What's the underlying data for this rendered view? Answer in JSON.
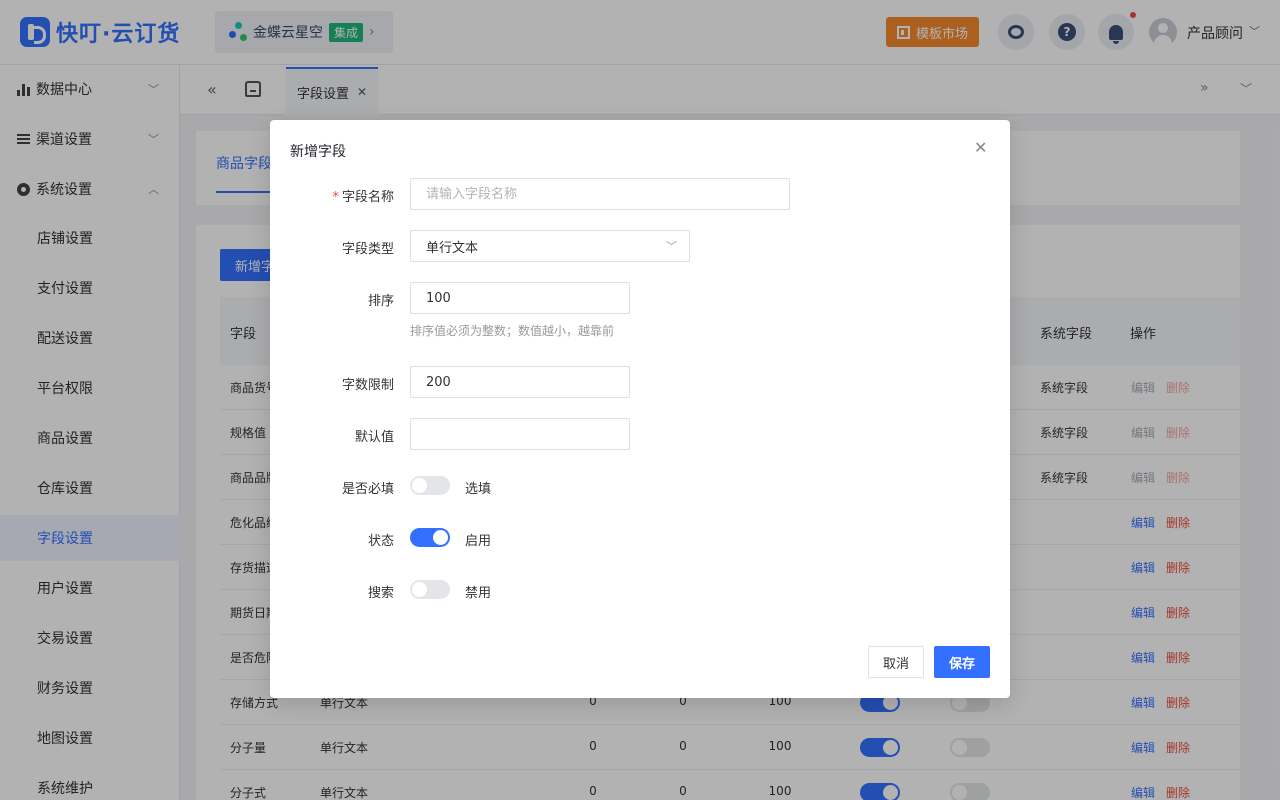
{
  "header": {
    "logo_text": "快叮·云订货",
    "integration_name": "金蝶云星空",
    "integration_badge": "集成",
    "market_button": "模板市场",
    "user_name": "产品顾问"
  },
  "sidebar": {
    "groups": [
      {
        "label": "数据中心"
      },
      {
        "label": "渠道设置"
      },
      {
        "label": "系统设置"
      }
    ],
    "items": [
      {
        "label": "店铺设置"
      },
      {
        "label": "支付设置"
      },
      {
        "label": "配送设置"
      },
      {
        "label": "平台权限"
      },
      {
        "label": "商品设置"
      },
      {
        "label": "仓库设置"
      },
      {
        "label": "字段设置",
        "active": true
      },
      {
        "label": "用户设置"
      },
      {
        "label": "交易设置"
      },
      {
        "label": "财务设置"
      },
      {
        "label": "地图设置"
      },
      {
        "label": "系统维护"
      }
    ]
  },
  "tabs": {
    "active_tab": "字段设置"
  },
  "content": {
    "subtab": "商品字段",
    "add_button": "新增字",
    "columns": [
      "字段",
      "系统字段",
      "操作"
    ],
    "rows": [
      {
        "name": "商品货号",
        "type": "",
        "a": "",
        "b": "",
        "c": "",
        "system": "系统字段",
        "edit": "编辑",
        "del": "删除",
        "dim": true
      },
      {
        "name": "规格值",
        "type": "",
        "a": "",
        "b": "",
        "c": "",
        "system": "系统字段",
        "edit": "编辑",
        "del": "删除",
        "dim": true
      },
      {
        "name": "商品品牌",
        "type": "",
        "a": "",
        "b": "",
        "c": "",
        "system": "系统字段",
        "edit": "编辑",
        "del": "删除",
        "dim": true
      },
      {
        "name": "危化品编",
        "type": "",
        "a": "",
        "b": "",
        "c": "",
        "system": "",
        "edit": "编辑",
        "del": "删除",
        "dim": false
      },
      {
        "name": "存货描述",
        "type": "",
        "a": "",
        "b": "",
        "c": "",
        "system": "",
        "edit": "编辑",
        "del": "删除",
        "dim": false
      },
      {
        "name": "期货日期",
        "type": "",
        "a": "",
        "b": "",
        "c": "",
        "system": "",
        "edit": "编辑",
        "del": "删除",
        "dim": false
      },
      {
        "name": "是否危险",
        "type": "",
        "a": "",
        "b": "",
        "c": "",
        "system": "",
        "edit": "编辑",
        "del": "删除",
        "dim": false
      },
      {
        "name": "存储方式",
        "type": "单行文本",
        "a": "0",
        "b": "0",
        "c": "100",
        "system": "",
        "edit": "编辑",
        "del": "删除",
        "dim": false
      },
      {
        "name": "分子量",
        "type": "单行文本",
        "a": "0",
        "b": "0",
        "c": "100",
        "system": "",
        "edit": "编辑",
        "del": "删除",
        "dim": false
      },
      {
        "name": "分子式",
        "type": "单行文本",
        "a": "0",
        "b": "0",
        "c": "100",
        "system": "",
        "edit": "编辑",
        "del": "删除",
        "dim": false
      }
    ]
  },
  "modal": {
    "title": "新增字段",
    "fields": {
      "name_label": "字段名称",
      "name_placeholder": "请输入字段名称",
      "name_value": "",
      "type_label": "字段类型",
      "type_value": "单行文本",
      "sort_label": "排序",
      "sort_value": "100",
      "sort_hint": "排序值必须为整数；数值越小，越靠前",
      "limit_label": "字数限制",
      "limit_value": "200",
      "default_label": "默认值",
      "default_value": "",
      "required_label": "是否必填",
      "required_state": "选填",
      "required_on": false,
      "status_label": "状态",
      "status_state": "启用",
      "status_on": true,
      "search_label": "搜索",
      "search_state": "禁用",
      "search_on": false
    },
    "cancel_label": "取消",
    "save_label": "保存"
  },
  "colors": {
    "primary": "#3370ff",
    "danger": "#f04a3d",
    "market": "#f58a2d",
    "badge": "#21b77a"
  }
}
